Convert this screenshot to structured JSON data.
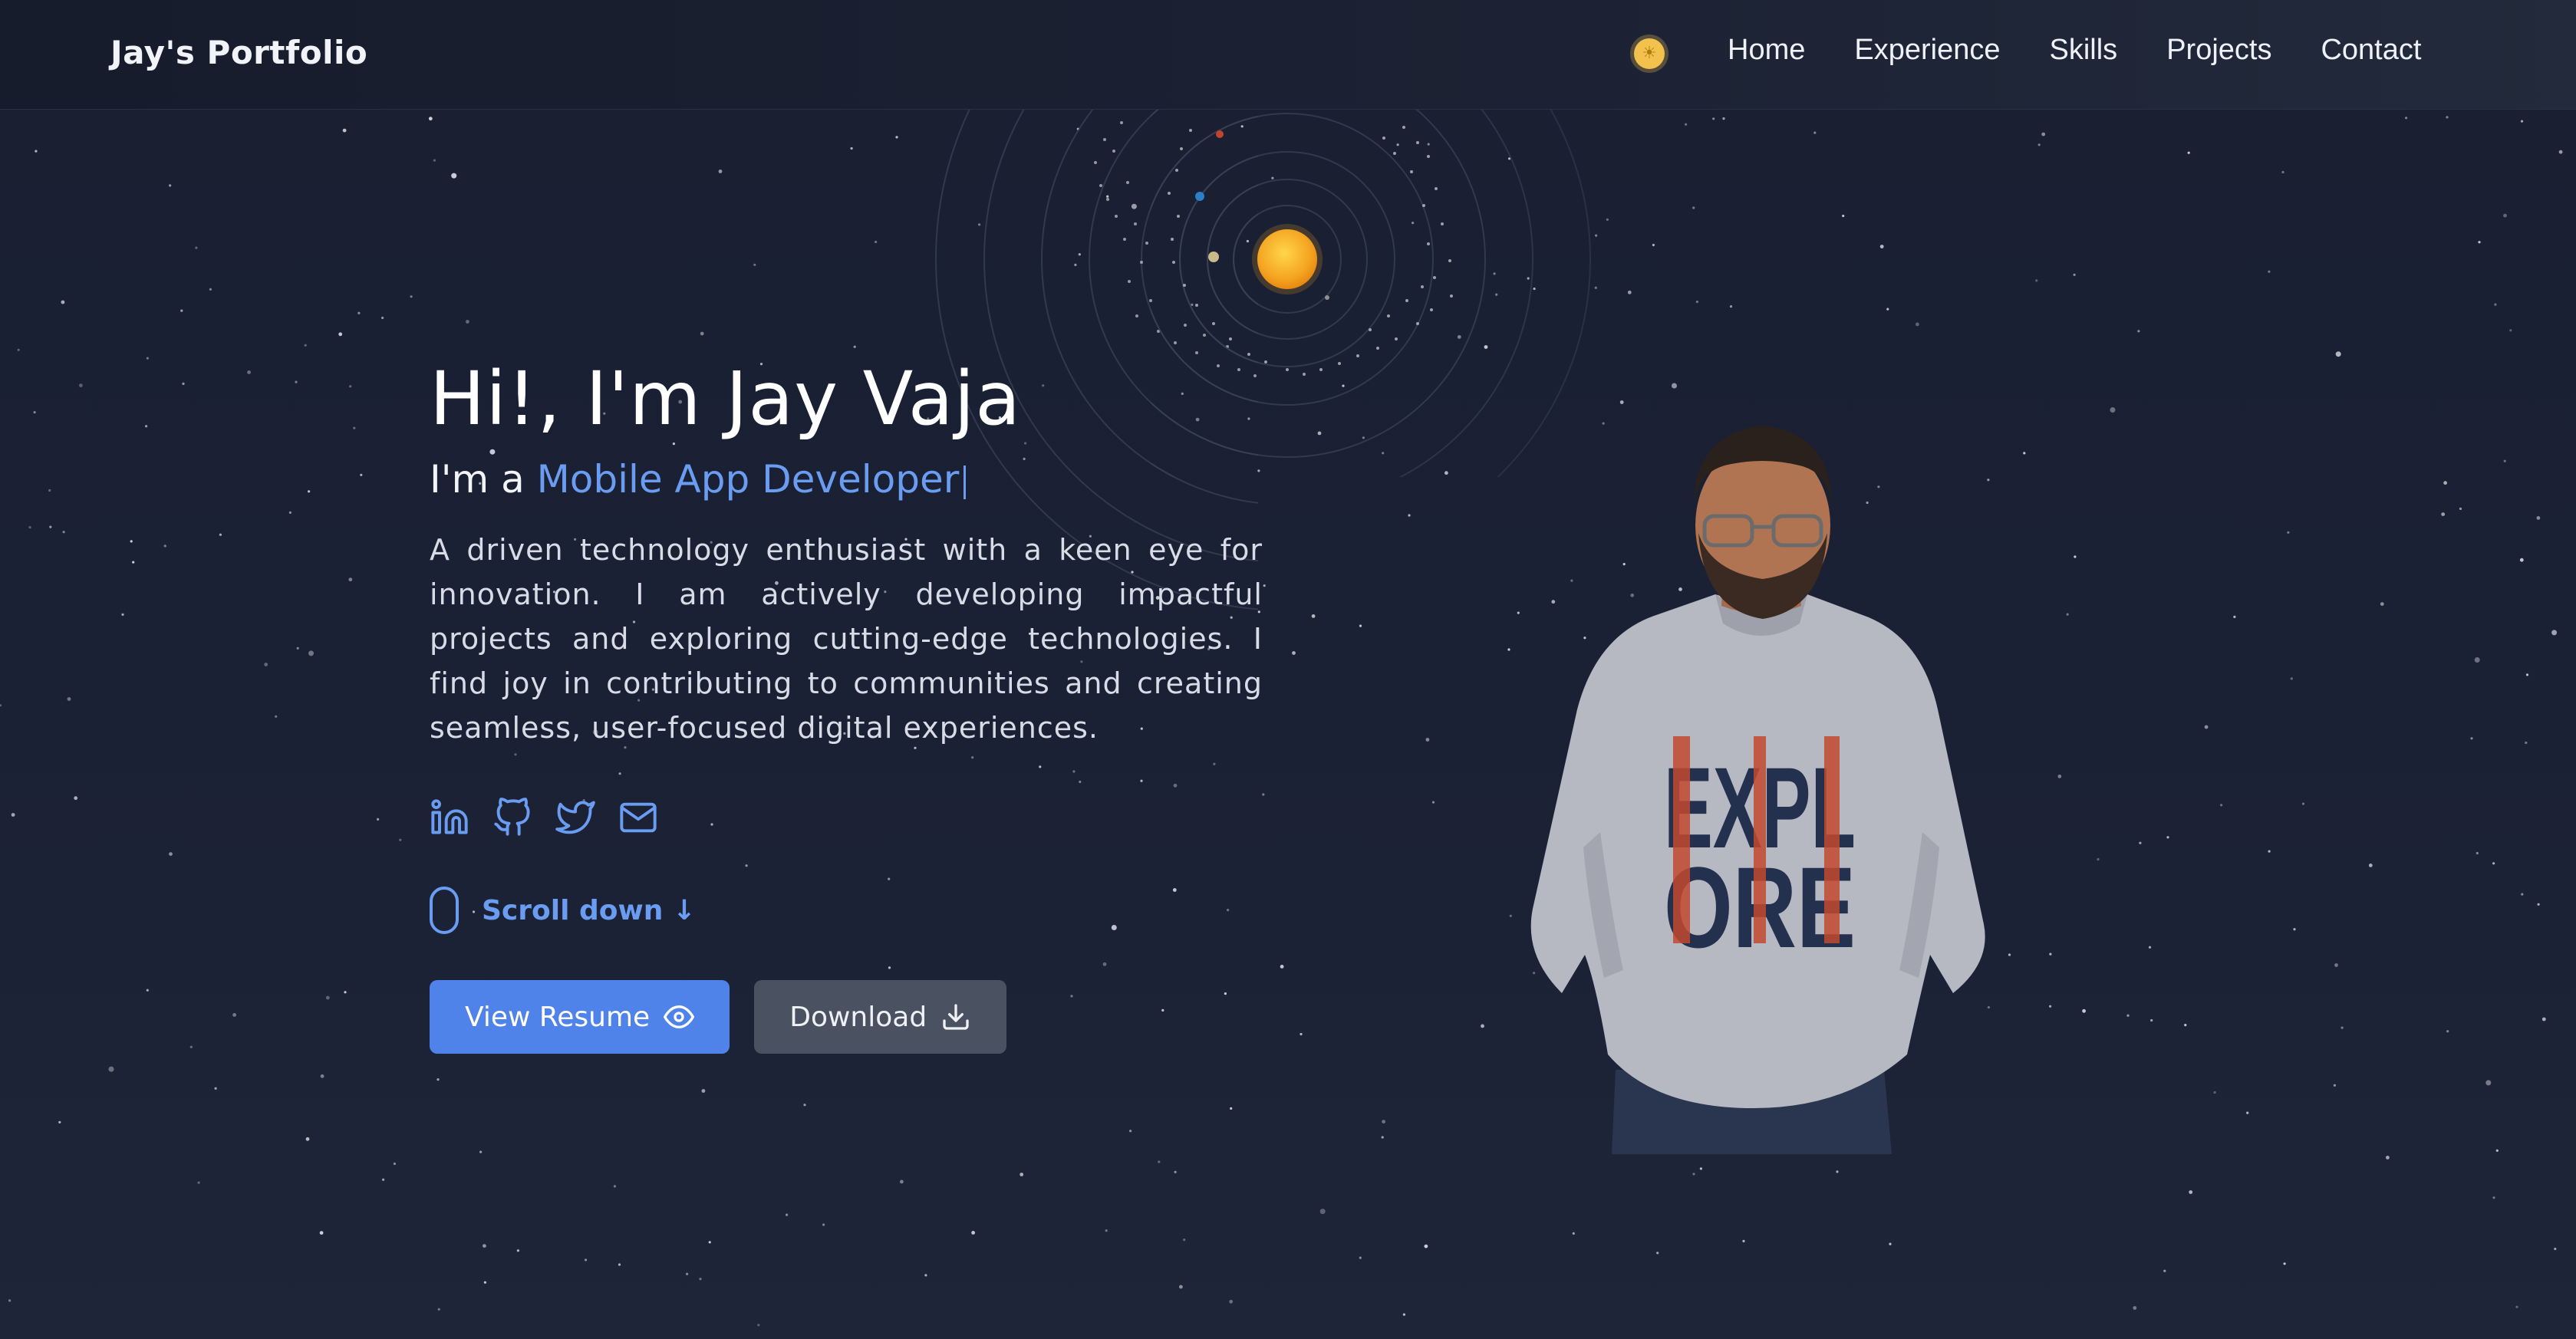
{
  "navbar": {
    "brand": "Jay's Portfolio",
    "theme_icon": "sun-icon",
    "links": [
      "Home",
      "Experience",
      "Skills",
      "Projects",
      "Contact"
    ]
  },
  "hero": {
    "greeting": "Hi!, I'm Jay Vaja",
    "role_prefix": "I'm a",
    "role": "Mobile App Developer",
    "bio": "A driven technology enthusiast with a keen eye for innovation. I am actively developing impactful projects and exploring cutting-edge technologies. I find joy in contributing to communities and creating seamless, user-focused digital experiences.",
    "socials": [
      "linkedin-icon",
      "github-icon",
      "twitter-icon",
      "mail-icon"
    ],
    "scroll_label": "Scroll down ↓",
    "buttons": {
      "view_resume": "View Resume",
      "download": "Download"
    },
    "sweater_text": [
      "EXPL",
      "ORE"
    ]
  },
  "colors": {
    "background": "#1a2032",
    "accent": "#6a9cf2",
    "primary_button": "#4f83ea",
    "secondary_button": "#4a5160",
    "sun": "#f5a623"
  }
}
